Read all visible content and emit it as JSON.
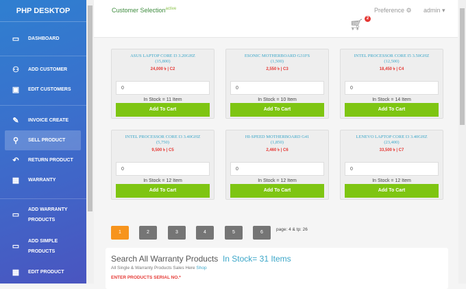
{
  "sidebar": {
    "brand": "PHP DESKTOP",
    "items": [
      {
        "label": "DASHBOARD",
        "icon": "dashboard-icon"
      },
      {
        "label": "ADD CUSTOMER",
        "icon": "add-user-icon"
      },
      {
        "label": "EDIT CUSTOMERS",
        "icon": "id-card-icon"
      },
      {
        "label": "INVOICE CREATE",
        "icon": "edit-icon"
      },
      {
        "label": "SELL PRODUCT",
        "icon": "search-icon"
      },
      {
        "label": "RETURN PRODUCT",
        "icon": "reply-icon"
      },
      {
        "label": "WARRANTY",
        "icon": "calculator-icon"
      },
      {
        "label": "ADD WARRANTY",
        "label2": "PRODUCTS",
        "icon": "wallet-icon"
      },
      {
        "label": "ADD SIMPLE",
        "label2": "PRODUCTS",
        "icon": "wallet-icon"
      },
      {
        "label": "EDIT PRODUCT",
        "icon": "calculator-icon"
      }
    ]
  },
  "header": {
    "title": "Customer Selection",
    "title_sup": "active",
    "preference": "Preference ⚙",
    "admin": "admin ▾",
    "cart_count": "2"
  },
  "products": [
    {
      "name": "ASUS LAPTOP CORE I3 3.20GHZ",
      "sub": "(15,800)",
      "price": "24,000 ৳ | C2",
      "qty": "0",
      "stock": "In Stock = 11 Item",
      "button": "Add To Cart"
    },
    {
      "name": "ESONIC MOTHERBOARD G31FS",
      "sub": "(1,500)",
      "price": "2,550 ৳ | C3",
      "qty": "0",
      "stock": "In Stock = 10 Item",
      "button": "Add To Cart"
    },
    {
      "name": "INTEL PROCESSOR CORE I5 3.50GHZ",
      "sub": "(12,500)",
      "price": "18,450 ৳ | C4",
      "qty": "0",
      "stock": "In Stock = 14 Item",
      "button": "Add To Cart"
    },
    {
      "name": "INTEL PROCESSOR CORE I3 3.40GHZ",
      "sub": "(5,750)",
      "price": "9,500 ৳ | C5",
      "qty": "0",
      "stock": "In Stock = 12 Item",
      "button": "Add To Cart"
    },
    {
      "name": "HI-SPEED MOTHERBOARD G41",
      "sub": "(1,850)",
      "price": "2,460 ৳ | C6",
      "qty": "0",
      "stock": "In Stock = 12 Item",
      "button": "Add To Cart"
    },
    {
      "name": "LENEVO LAPTOP CORE I3 3.40GHZ",
      "sub": "(23,400)",
      "price": "33,500 ৳ | C7",
      "qty": "0",
      "stock": "In Stock = 12 Item",
      "button": "Add To Cart"
    }
  ],
  "pagination": {
    "pages": [
      "1",
      "2",
      "3",
      "4",
      "5",
      "6"
    ],
    "current": "1",
    "info": "page: 4 & tp: 26"
  },
  "search_panel": {
    "title": "Search All Warranty Products",
    "stock": "In Stock= 31 Items",
    "subtitle": "All Single & Warranty Products Sales Here",
    "shop_link": "Shop",
    "field_label": "ENTER PRODUCTS SERIAL NO.*"
  }
}
